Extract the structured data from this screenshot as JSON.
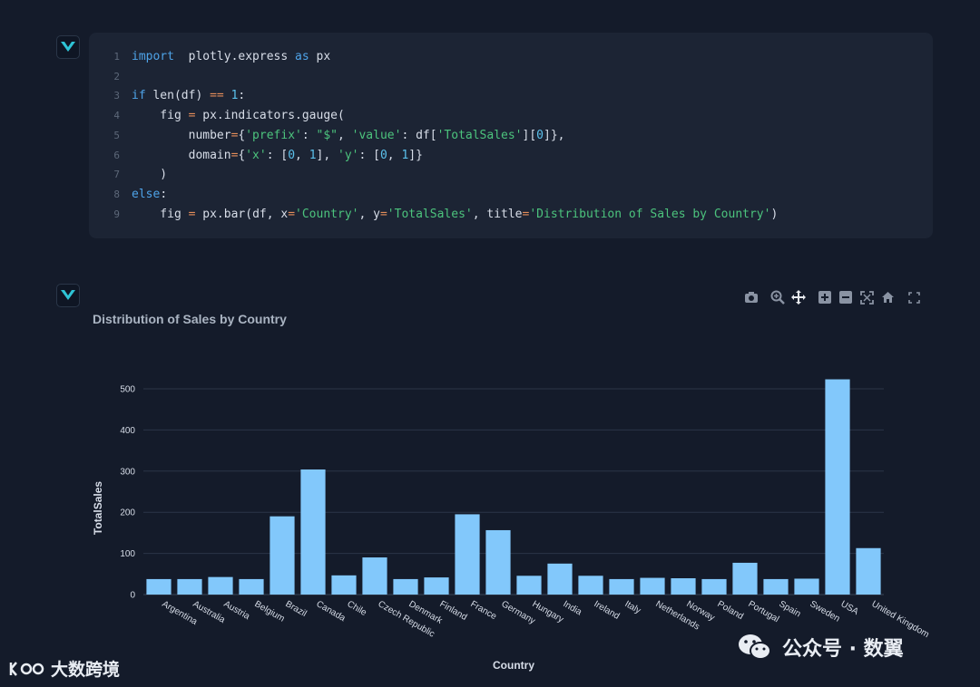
{
  "code": {
    "lines": [
      {
        "n": "1",
        "parts": [
          [
            "kw",
            "import"
          ],
          [
            "",
            "  plotly.express "
          ],
          [
            "kw",
            "as"
          ],
          [
            "",
            " px"
          ]
        ]
      },
      {
        "n": "2",
        "parts": []
      },
      {
        "n": "3",
        "parts": [
          [
            "kw",
            "if"
          ],
          [
            "",
            " len(df) "
          ],
          [
            "op",
            "=="
          ],
          [
            "",
            " "
          ],
          [
            "num",
            "1"
          ],
          [
            "",
            ":"
          ]
        ]
      },
      {
        "n": "4",
        "parts": [
          [
            "",
            "    fig "
          ],
          [
            "op",
            "="
          ],
          [
            "",
            " px.indicators.gauge("
          ]
        ]
      },
      {
        "n": "5",
        "parts": [
          [
            "",
            "        number"
          ],
          [
            "op",
            "="
          ],
          [
            "",
            "{"
          ],
          [
            "str",
            "'prefix'"
          ],
          [
            "",
            ": "
          ],
          [
            "str",
            "\"$\""
          ],
          [
            "",
            ", "
          ],
          [
            "str",
            "'value'"
          ],
          [
            "",
            ": df["
          ],
          [
            "str",
            "'TotalSales'"
          ],
          [
            "",
            "]["
          ],
          [
            "num",
            "0"
          ],
          [
            "",
            "]},"
          ]
        ]
      },
      {
        "n": "6",
        "parts": [
          [
            "",
            "        domain"
          ],
          [
            "op",
            "="
          ],
          [
            "",
            "{"
          ],
          [
            "str",
            "'x'"
          ],
          [
            "",
            ": ["
          ],
          [
            "num",
            "0"
          ],
          [
            "",
            ", "
          ],
          [
            "num",
            "1"
          ],
          [
            "",
            "], "
          ],
          [
            "str",
            "'y'"
          ],
          [
            "",
            ": ["
          ],
          [
            "num",
            "0"
          ],
          [
            "",
            ", "
          ],
          [
            "num",
            "1"
          ],
          [
            "",
            "]}"
          ]
        ]
      },
      {
        "n": "7",
        "parts": [
          [
            "",
            "    )"
          ]
        ]
      },
      {
        "n": "8",
        "parts": [
          [
            "kw",
            "else"
          ],
          [
            "",
            ":"
          ]
        ]
      },
      {
        "n": "9",
        "parts": [
          [
            "",
            "    fig "
          ],
          [
            "op",
            "="
          ],
          [
            "",
            " px.bar(df, x"
          ],
          [
            "op",
            "="
          ],
          [
            "str",
            "'Country'"
          ],
          [
            "",
            ", y"
          ],
          [
            "op",
            "="
          ],
          [
            "str",
            "'TotalSales'"
          ],
          [
            "",
            ", title"
          ],
          [
            "op",
            "="
          ],
          [
            "str",
            "'Distribution of Sales by Country'"
          ],
          [
            "",
            ")"
          ]
        ]
      }
    ]
  },
  "toolbar": {
    "buttons": [
      "camera-icon",
      "zoom-icon",
      "pan-icon",
      "zoom-in-icon",
      "zoom-out-icon",
      "autoscale-icon",
      "reset-axes-icon",
      "fullscreen-icon"
    ]
  },
  "chart_data": {
    "type": "bar",
    "title": "Distribution of Sales by Country",
    "xlabel": "Country",
    "ylabel": "TotalSales",
    "ylim": [
      0,
      550
    ],
    "yticks": [
      0,
      100,
      200,
      300,
      400,
      500
    ],
    "grid": true,
    "bar_color": "#82c8fb",
    "categories": [
      "Argentina",
      "Australia",
      "Austria",
      "Belgium",
      "Brazil",
      "Canada",
      "Chile",
      "Czech Republic",
      "Denmark",
      "Finland",
      "France",
      "Germany",
      "Hungary",
      "India",
      "Ireland",
      "Italy",
      "Netherlands",
      "Norway",
      "Poland",
      "Portugal",
      "Spain",
      "Sweden",
      "USA",
      "United Kingdom"
    ],
    "values": [
      37.62,
      37.62,
      42.62,
      37.62,
      190.1,
      303.96,
      46.62,
      90.24,
      37.62,
      41.62,
      195.1,
      156.48,
      45.62,
      75.26,
      45.62,
      37.62,
      40.62,
      39.62,
      37.62,
      77.24,
      37.62,
      38.62,
      523.06,
      112.86
    ]
  },
  "watermark": {
    "left_text": "大数跨境",
    "right_text": "公众号 · 数翼"
  }
}
